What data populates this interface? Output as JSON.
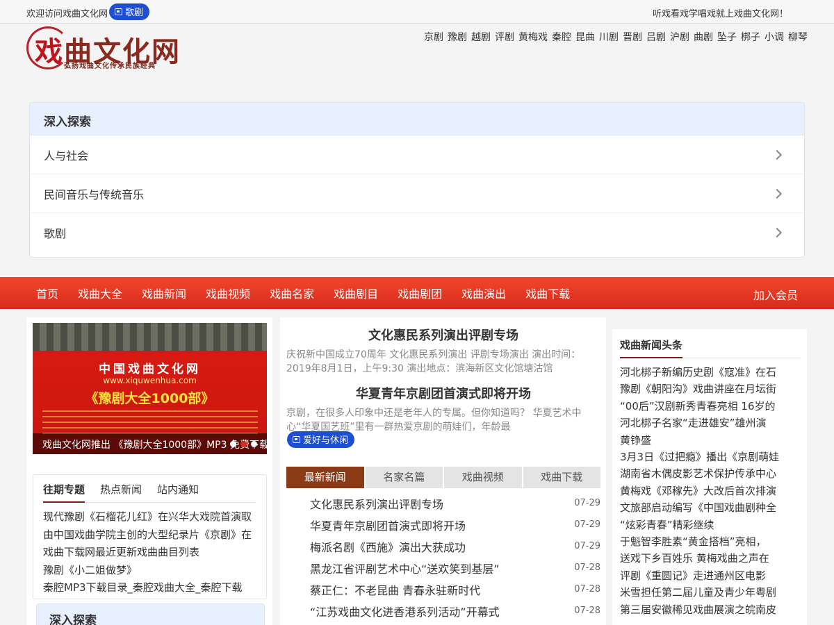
{
  "topbar": {
    "welcome": "欢迎访问戏曲文化网",
    "badge": "歌剧",
    "slogan": "听戏看戏学唱戏就上戏曲文化网！"
  },
  "logo": {
    "title_first": "戏",
    "title_rest": "曲文化网",
    "subtitle": "弘扬戏曲文化传承民族经典"
  },
  "quick_nav": [
    "京剧",
    "豫剧",
    "越剧",
    "评剧",
    "黄梅戏",
    "秦腔",
    "昆曲",
    "川剧",
    "晋剧",
    "吕剧",
    "沪剧",
    "曲剧",
    "坠子",
    "梆子",
    "小调",
    "柳琴"
  ],
  "explore": {
    "title": "深入探索",
    "items": [
      {
        "label": "人与社会"
      },
      {
        "label": "民间音乐与传统音乐"
      },
      {
        "label": "歌剧"
      }
    ]
  },
  "main_nav": {
    "items": [
      "首页",
      "戏曲大全",
      "戏曲新闻",
      "戏曲视频",
      "戏曲名家",
      "戏曲剧目",
      "戏曲剧团",
      "戏曲演出",
      "戏曲下载"
    ],
    "join": "加入会员"
  },
  "banner": {
    "line1": "中国戏曲文化网",
    "line2": "www.xiquwenhua.com",
    "line3": "《豫剧大全1000部》",
    "caption": "戏曲文化网推出 《豫剧大全1000部》MP3 免费下载"
  },
  "topics": {
    "tabs": [
      "往期专题",
      "热点新闻",
      "站内通知"
    ],
    "items": [
      "现代豫剧《石榴花儿红》在兴华大戏院首演取",
      "由中国戏曲学院主创的大型纪录片《京剧》在",
      "戏曲下载网最近更新戏曲曲目列表",
      "豫剧《小二姐做梦》",
      "秦腔MP3下载目录_秦腔戏曲大全_秦腔下载"
    ]
  },
  "explore2": {
    "title": "深入探索"
  },
  "features": [
    {
      "title": "文化惠民系列演出评剧专场",
      "summary": "庆祝新中国成立70周年 文化惠民系列演出 评剧专场演出 演出时间：2019年8月1日，上午9:30 演出地点：滨海新区文化馆塘沽馆"
    },
    {
      "title": "华夏青年京剧团首演式即将开场",
      "summary": "京剧，在很多人印象中还是老年人的专属。但你知道吗？ 华夏艺术中心“华夏国艺班”里有一群热爱京剧的萌娃们，年龄最"
    }
  ],
  "mid_badge": "爱好与休闲",
  "news_tabs": [
    "最新新闻",
    "名家名篇",
    "戏曲视频",
    "戏曲下载"
  ],
  "news": [
    {
      "title": "文化惠民系列演出评剧专场",
      "date": "07-29"
    },
    {
      "title": "华夏青年京剧团首演式即将开场",
      "date": "07-29"
    },
    {
      "title": "梅派名剧《西施》演出大获成功",
      "date": "07-29"
    },
    {
      "title": "黑龙江省评剧艺术中心“送欢笑到基层”",
      "date": "07-28"
    },
    {
      "title": "蔡正仁：不老昆曲 青春永驻新时代",
      "date": "07-28"
    },
    {
      "title": "“江苏戏曲文化进香港系列活动”开幕式",
      "date": "07-28"
    }
  ],
  "headlines": {
    "title": "戏曲新闻头条",
    "items": [
      "河北梆子新编历史剧《寇准》在石",
      "豫剧《朝阳沟》戏曲讲座在月坛街",
      "“00后”汉剧新秀青春亮相 16岁的",
      "河北梆子名家“走进雄安”雄州演",
      "黄铮盛",
      "3月3日《过把瘾》播出《京剧萌娃",
      "湖南省木偶皮影艺术保护传承中心",
      "黄梅戏《邓稼先》大改后首次排演",
      "文旅部启动编写《中国戏曲剧种全",
      "“炫彩青春”精彩继续",
      "于魁智李胜素“黄金搭档”亮相，",
      "送戏下乡百姓乐 黄梅戏曲之声在",
      "评剧《重圆记》走进通州区电影",
      "米雪担任第二届儿童及青少年粤剧",
      "第三届安徽稀见戏曲展演之皖南皮"
    ]
  },
  "colors": {
    "nav_red": "#d82b1b",
    "badge_blue": "#1c4fd2",
    "tab_brown": "#8b3a16",
    "panel_head": "#e8efff"
  }
}
